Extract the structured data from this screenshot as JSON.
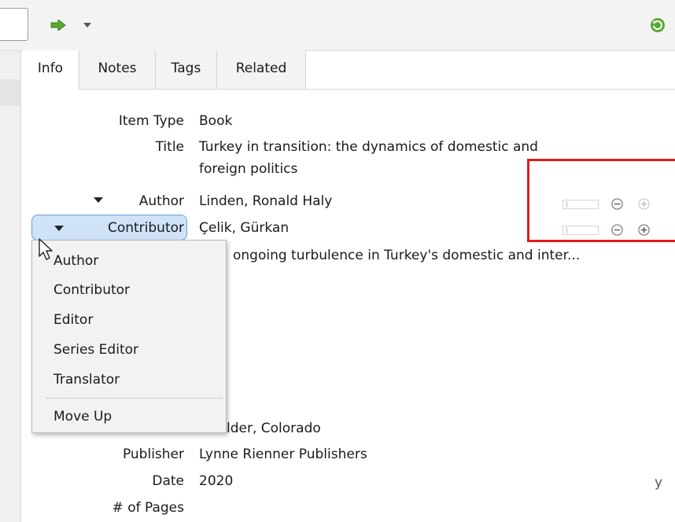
{
  "tabs": [
    "Info",
    "Notes",
    "Tags",
    "Related"
  ],
  "fields": {
    "item_type": {
      "label": "Item Type",
      "value": "Book"
    },
    "title": {
      "label": "Title",
      "value_line1": "Turkey in transition: the dynamics of domestic and",
      "value_line2": "foreign politics"
    },
    "author": {
      "label": "Author",
      "value": "Linden, Ronald Haly"
    },
    "contributor": {
      "label": "Contributor",
      "value": "Çelik, Gürkan"
    },
    "abstract": {
      "value": "ongoing turbulence in Turkey's domestic and inter..."
    },
    "place": {
      "value": "lder, Colorado"
    },
    "publisher": {
      "label": "Publisher",
      "value": "Lynne Rienner Publishers"
    },
    "date": {
      "label": "Date",
      "value": "2020",
      "suffix": "y"
    },
    "pages": {
      "label": "# of Pages"
    }
  },
  "creator_menu": {
    "items": [
      "Author",
      "Contributor",
      "Editor",
      "Series Editor",
      "Translator"
    ],
    "move_up": "Move Up"
  },
  "colors": {
    "accent_red": "#e01b1b",
    "selection_blue": "#cfe2f8",
    "arrow_green": "#5aa832"
  },
  "icons": [
    "forward-arrow-icon",
    "dropdown-arrow-icon",
    "sync-icon",
    "minus-circle-icon",
    "plus-circle-icon",
    "mouse-cursor-icon"
  ]
}
